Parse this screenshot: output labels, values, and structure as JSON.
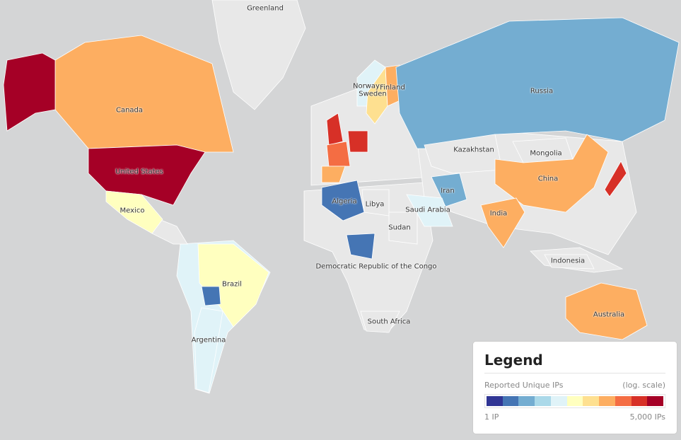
{
  "legend": {
    "title": "Legend",
    "metric": "Reported Unique IPs",
    "scale_note": "(log. scale)",
    "min_label": "1 IP",
    "max_label": "5,000 IPs",
    "colors": [
      "#313695",
      "#4575b4",
      "#74add1",
      "#abd9e9",
      "#e0f3f8",
      "#ffffbf",
      "#fee090",
      "#fdae61",
      "#f46d43",
      "#d73027",
      "#a50026"
    ]
  },
  "colors": {
    "ocean": "#d4d5d6",
    "no_data": "#e8e8e8"
  },
  "countries": [
    {
      "name": "Greenland",
      "level": null
    },
    {
      "name": "Canada",
      "level": 7
    },
    {
      "name": "United States",
      "level": 10
    },
    {
      "name": "Mexico",
      "level": 5
    },
    {
      "name": "Brazil",
      "level": 5
    },
    {
      "name": "Argentina",
      "level": 4
    },
    {
      "name": "Norway",
      "level": 4
    },
    {
      "name": "Sweden",
      "level": 6
    },
    {
      "name": "Finland",
      "level": 7
    },
    {
      "name": "Russia",
      "level": 2
    },
    {
      "name": "Kazakhstan",
      "level": null
    },
    {
      "name": "Mongolia",
      "level": null
    },
    {
      "name": "China",
      "level": 7
    },
    {
      "name": "India",
      "level": 7
    },
    {
      "name": "Iran",
      "level": 2
    },
    {
      "name": "Saudi Arabia",
      "level": 4
    },
    {
      "name": "Algeria",
      "level": 1
    },
    {
      "name": "Libya",
      "level": null
    },
    {
      "name": "Sudan",
      "level": null
    },
    {
      "name": "Democratic Republic of the Congo",
      "level": 1
    },
    {
      "name": "South Africa",
      "level": null
    },
    {
      "name": "Indonesia",
      "level": null
    },
    {
      "name": "Australia",
      "level": 7
    }
  ]
}
